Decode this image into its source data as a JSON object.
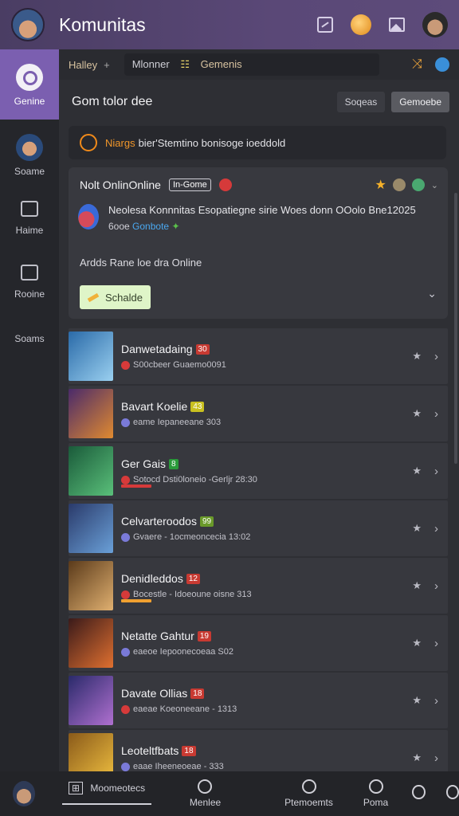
{
  "header": {
    "title": "Komunitas"
  },
  "rail": {
    "items": [
      {
        "label": "Genine"
      },
      {
        "label": "Soame"
      },
      {
        "label": "Haime"
      },
      {
        "label": "Rooine"
      },
      {
        "label": "Soams"
      }
    ]
  },
  "breadcrumb": {
    "first": "Halley",
    "sep": "+",
    "current": "Mlonner",
    "current_tag": "☷",
    "path": "Gemenis"
  },
  "page": {
    "title": "Gom tolor dee",
    "btn_secondary": "Soqeas",
    "btn_primary": "Gemoebe"
  },
  "notice": {
    "highlight": "Niargs",
    "text": "bier'Stemtino bonisoge ioeddold"
  },
  "card": {
    "head_label": "Nolt OnlinOnline",
    "tag": "In-Gome",
    "description": "Neolesa Konnnitas Esopatiegne sirie Woes donn OOolo Bne12025",
    "sub_prefix": "6ooe",
    "sub_link": "Gonbote",
    "online_text": "Ardds Rane loe dra Online",
    "schedule_label": "Schalde"
  },
  "list": [
    {
      "title": "Danwetadaing",
      "badge": "30",
      "badge_color": "#c83a32",
      "sub": "S00cbeer Guaemo0091",
      "thumb": [
        "#2a6aa8",
        "#9ad0f0"
      ],
      "progress": null
    },
    {
      "title": "Bavart Koelie",
      "badge": "43",
      "badge_color": "#c9c020",
      "sub": "eame Iepaneeane 303",
      "thumb": [
        "#4a2a6a",
        "#e08a30"
      ],
      "progress": null
    },
    {
      "title": "Ger Gais",
      "badge": "8",
      "badge_color": "#2a9a3a",
      "sub": "Sotocd Dsti0loneio -Gerljr 28:30",
      "thumb": [
        "#1a5a3a",
        "#5ac07a"
      ],
      "progress": "#d63a3a"
    },
    {
      "title": "Celvarteroodos",
      "badge": "99",
      "badge_color": "#6a9a2a",
      "sub": "Gvaere - 1ocmeoncecia 13:02",
      "thumb": [
        "#2a3a6a",
        "#6aa0d8"
      ],
      "progress": null
    },
    {
      "title": "Denidleddos",
      "badge": "12",
      "badge_color": "#c83a32",
      "sub": "Bocestle - Idoeoune oisne 313",
      "thumb": [
        "#5a3a1a",
        "#e0b070"
      ],
      "progress": "#f0a030"
    },
    {
      "title": "Netatte Gahtur",
      "badge": "19",
      "badge_color": "#c83a32",
      "sub": "eaeoe Iepoonecoeaa S02",
      "thumb": [
        "#3a1a1a",
        "#e07030"
      ],
      "progress": null
    },
    {
      "title": "Davate Ollias",
      "badge": "18",
      "badge_color": "#c83a32",
      "sub": "eaeae Koeoneeane - 1313",
      "thumb": [
        "#2a2a6a",
        "#b070d0"
      ],
      "progress": null
    },
    {
      "title": "Leoteltfbats",
      "badge": "18",
      "badge_color": "#c83a32",
      "sub": "eaae Iheeneoeae - 333",
      "thumb": [
        "#8a5a1a",
        "#f0c040"
      ],
      "progress": null
    }
  ],
  "bottom_nav": {
    "tabs": [
      {
        "label": "Moomeotecs"
      },
      {
        "label": "Menlee"
      },
      {
        "label": "Ptemoemts"
      },
      {
        "label": "Poma"
      }
    ]
  },
  "colors": {
    "accent": "#7b5fb0",
    "header_bg": "#4a3d63"
  }
}
